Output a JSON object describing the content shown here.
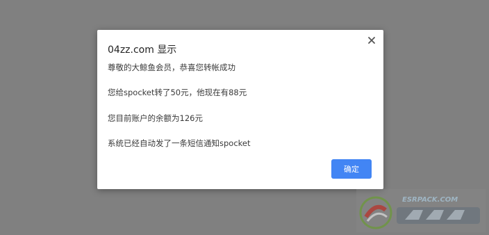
{
  "dialog": {
    "title": "04zz.com 显示",
    "lines": [
      "尊敬的大鲸鱼会员，恭喜您转帐成功",
      "您给spocket转了50元，他现在有88元",
      "您目前账户的余额为126元",
      "系统已经自动发了一条短信通知spocket"
    ],
    "ok_label": "确定",
    "close_icon": "close-icon"
  },
  "watermark": {
    "site_text": "ESRPACK.COM"
  },
  "colors": {
    "backdrop": "#808080",
    "dialog_bg": "#ffffff",
    "ok_button": "#4285f4"
  }
}
